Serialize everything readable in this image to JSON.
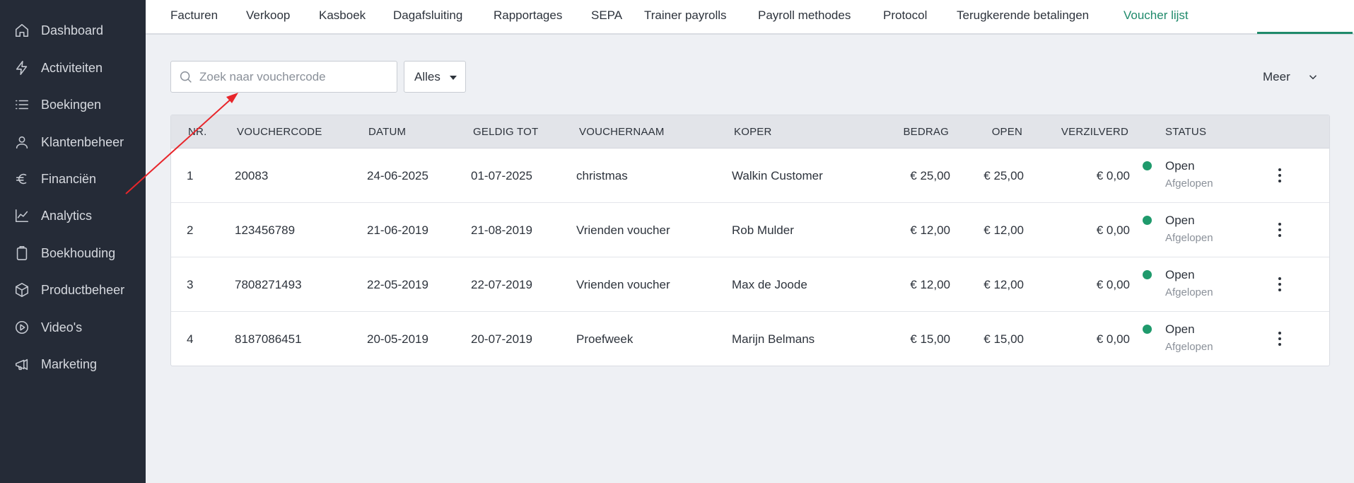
{
  "sidebar": {
    "items": [
      {
        "label": "Dashboard",
        "icon": "home-icon"
      },
      {
        "label": "Activiteiten",
        "icon": "bolt-icon"
      },
      {
        "label": "Boekingen",
        "icon": "list-icon"
      },
      {
        "label": "Klantenbeheer",
        "icon": "user-icon"
      },
      {
        "label": "Financiën",
        "icon": "euro-icon"
      },
      {
        "label": "Analytics",
        "icon": "chart-line-icon"
      },
      {
        "label": "Boekhouding",
        "icon": "clipboard-icon"
      },
      {
        "label": "Productbeheer",
        "icon": "box-icon"
      },
      {
        "label": "Video's",
        "icon": "play-circle-icon"
      },
      {
        "label": "Marketing",
        "icon": "megaphone-icon"
      }
    ]
  },
  "tabs": [
    {
      "label": "Facturen"
    },
    {
      "label": "Verkoop"
    },
    {
      "label": "Kasboek"
    },
    {
      "label": "Dagafsluiting"
    },
    {
      "label": "Rapportages"
    },
    {
      "label": "SEPA"
    },
    {
      "label": "Trainer payrolls"
    },
    {
      "label": "Payroll methodes"
    },
    {
      "label": "Protocol"
    },
    {
      "label": "Terugkerende betalingen"
    },
    {
      "label": "Voucher lijst",
      "active": true
    }
  ],
  "toolbar": {
    "search_placeholder": "Zoek naar vouchercode",
    "search_value": "",
    "filter_label": "Alles",
    "more_label": "Meer"
  },
  "table": {
    "columns": {
      "nr": "NR.",
      "code": "VOUCHERCODE",
      "datum": "DATUM",
      "geldig": "GELDIG TOT",
      "naam": "VOUCHERNAAM",
      "koper": "KOPER",
      "bedrag": "BEDRAG",
      "open": "OPEN",
      "verzilverd": "VERZILVERD",
      "status": "STATUS"
    },
    "rows": [
      {
        "nr": "1",
        "code": "20083",
        "datum": "24-06-2025",
        "geldig": "01-07-2025",
        "naam": "christmas",
        "koper": "Walkin Customer",
        "bedrag": "€ 25,00",
        "open": "€ 25,00",
        "verzilverd": "€ 0,00",
        "status": "Open",
        "substatus": "Afgelopen"
      },
      {
        "nr": "2",
        "code": "123456789",
        "datum": "21-06-2019",
        "geldig": "21-08-2019",
        "naam": "Vrienden voucher",
        "koper": "Rob Mulder",
        "bedrag": "€ 12,00",
        "open": "€ 12,00",
        "verzilverd": "€ 0,00",
        "status": "Open",
        "substatus": "Afgelopen"
      },
      {
        "nr": "3",
        "code": "7808271493",
        "datum": "22-05-2019",
        "geldig": "22-07-2019",
        "naam": "Vrienden voucher",
        "koper": "Max de Joode",
        "bedrag": "€ 12,00",
        "open": "€ 12,00",
        "verzilverd": "€ 0,00",
        "status": "Open",
        "substatus": "Afgelopen"
      },
      {
        "nr": "4",
        "code": "8187086451",
        "datum": "20-05-2019",
        "geldig": "20-07-2019",
        "naam": "Proefweek",
        "koper": "Marijn Belmans",
        "bedrag": "€ 15,00",
        "open": "€ 15,00",
        "verzilverd": "€ 0,00",
        "status": "Open",
        "substatus": "Afgelopen"
      }
    ]
  },
  "colors": {
    "sidebar_bg": "#252b37",
    "accent": "#1f8a6b",
    "status_open": "#1f9a6c",
    "annotation_arrow": "#e8262b"
  }
}
